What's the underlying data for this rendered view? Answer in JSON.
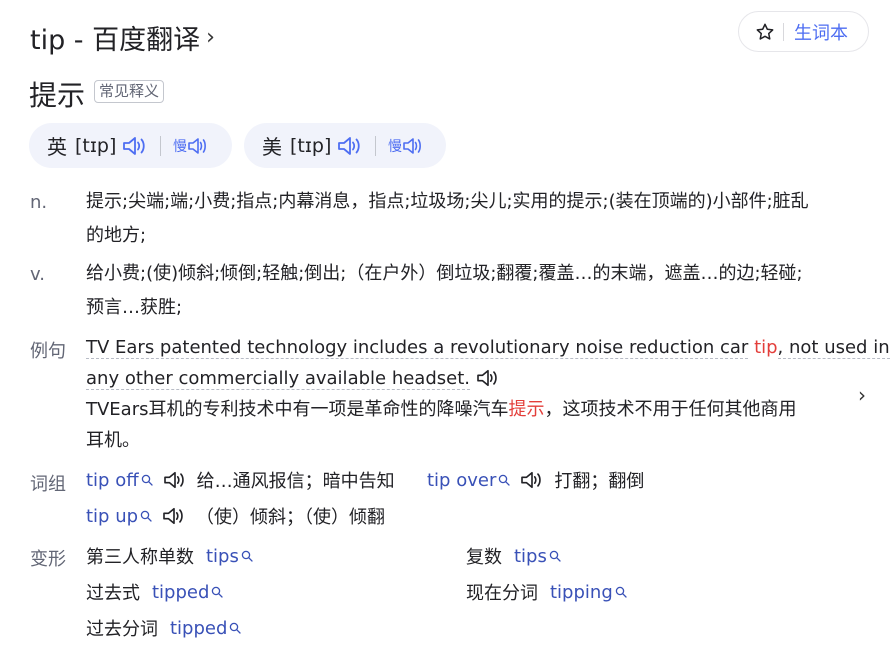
{
  "header": {
    "title": "tip - 百度翻译",
    "title_chevron": "›",
    "vocab_label": "生词本",
    "vocab_icon": "star-icon"
  },
  "main_meaning": "提示",
  "common_tag": "常见释义",
  "pronunciations": [
    {
      "region": "英",
      "phonetic": "[tɪp]"
    },
    {
      "region": "美",
      "phonetic": "[tɪp]"
    }
  ],
  "definitions": [
    {
      "pos": "n.",
      "line1": "提示;尖端;端;小费;指点;内幕消息，指点;垃圾场;尖儿;实用的提示;(装在顶端的)小部件;脏乱",
      "line2": "的地方;"
    },
    {
      "pos": "v.",
      "line1": "给小费;(使)倾斜;倾倒;轻触;倒出;（在户外）倒垃圾;翻覆;覆盖…的末端，遮盖…的边;轻碰;",
      "line2": "预言…获胜;"
    }
  ],
  "example": {
    "label": "例句",
    "en_pre": "TV Ears patented technology includes a revolutionary noise reduction car",
    "en_keyword": "tip",
    "en_post": ", not used in",
    "en_line2": "any other commercially available headset.",
    "zh_pre": "TVEars耳机的专利技术中有一项是革命性的降噪汽车",
    "zh_keyword": "提示",
    "zh_post": "，这项技术不用于任何其他商用",
    "zh_line2": "耳机。",
    "next_arrow": "›"
  },
  "phrases": {
    "label": "词组",
    "items": [
      {
        "term": "tip off",
        "meaning": "给…通风报信；暗中告知"
      },
      {
        "term": "tip over",
        "meaning": "打翻；翻倒"
      },
      {
        "term": "tip up",
        "meaning": "（使）倾斜；（使）倾翻"
      }
    ]
  },
  "forms": {
    "label": "变形",
    "items": [
      {
        "label": "第三人称单数",
        "word": "tips"
      },
      {
        "label": "复数",
        "word": "tips"
      },
      {
        "label": "过去式",
        "word": "tipped"
      },
      {
        "label": "现在分词",
        "word": "tipping"
      },
      {
        "label": "过去分词",
        "word": "tipped"
      }
    ]
  },
  "colors": {
    "accent": "#4e6ef2",
    "link": "#3951b7",
    "highlight": "#e33e3a",
    "pron_bg": "#f1f3fb"
  }
}
